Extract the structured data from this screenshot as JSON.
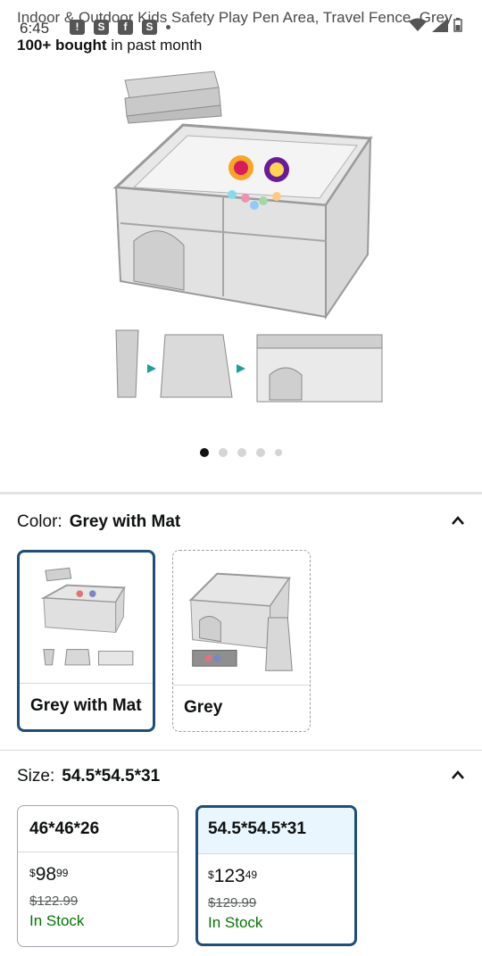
{
  "status_bar": {
    "time": "6:45",
    "notif_icons": [
      "alert-icon",
      "s-icon",
      "facebook-icon",
      "s-icon"
    ]
  },
  "product": {
    "title": "Indoor & Outdoor Kids Safety Play Pen Area, Travel Fence, Grey",
    "bought_bold": "100+ bought",
    "bought_rest": " in past month"
  },
  "carousel": {
    "count": 5,
    "active_index": 0
  },
  "color_section": {
    "label": "Color:",
    "value": "Grey with Mat",
    "options": [
      {
        "label": "Grey with Mat",
        "selected": true
      },
      {
        "label": "Grey",
        "selected": false
      }
    ]
  },
  "size_section": {
    "label": "Size:",
    "value": "54.5*54.5*31",
    "options": [
      {
        "label": "46*46*26",
        "price_symbol": "$",
        "price_whole": "98",
        "price_cents": "99",
        "list_price": "$122.99",
        "stock": "In Stock",
        "selected": false
      },
      {
        "label": "54.5*54.5*31",
        "price_symbol": "$",
        "price_whole": "123",
        "price_cents": "49",
        "list_price": "$129.99",
        "stock": "In Stock",
        "selected": true
      }
    ]
  },
  "colors": {
    "selected_border": "#1e4e79",
    "in_stock": "#007600",
    "selected_head_bg": "#eaf6fe"
  }
}
